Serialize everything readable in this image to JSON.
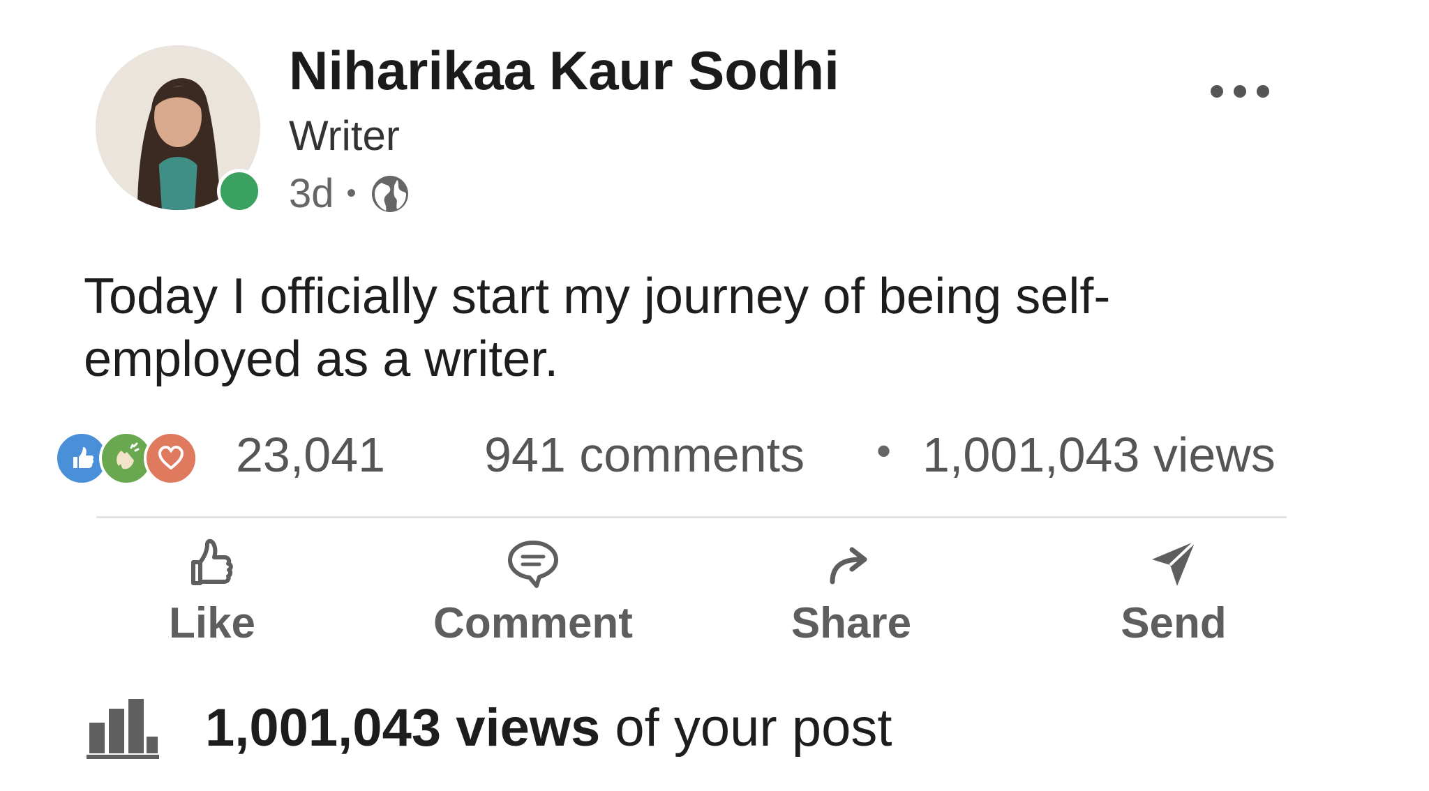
{
  "author": {
    "name": "Niharikaa Kaur Sodhi",
    "headline": "Writer",
    "time_ago": "3d",
    "separator": "•",
    "visibility_icon": "globe-icon",
    "online": true
  },
  "post": {
    "text": "Today I officially start my journey of being self-employed as a writer."
  },
  "social_counts": {
    "reaction_icons": [
      "like-reaction-icon",
      "celebrate-reaction-icon",
      "love-reaction-icon"
    ],
    "reactions": "23,041",
    "comments": "941 comments",
    "separator": "•",
    "views": "1,001,043 views"
  },
  "actions": [
    {
      "label": "Like",
      "icon": "thumbs-up-icon"
    },
    {
      "label": "Comment",
      "icon": "comment-icon"
    },
    {
      "label": "Share",
      "icon": "share-arrow-icon"
    },
    {
      "label": "Send",
      "icon": "send-icon"
    }
  ],
  "analytics": {
    "icon": "bar-chart-icon",
    "views_bold": "1,001,043 views",
    "suffix": " of your post"
  },
  "colors": {
    "online": "#3aa160",
    "like": "#4a90d9",
    "celebrate": "#6aa84f",
    "love": "#e07a5f",
    "action_text": "#5e5e5e"
  }
}
